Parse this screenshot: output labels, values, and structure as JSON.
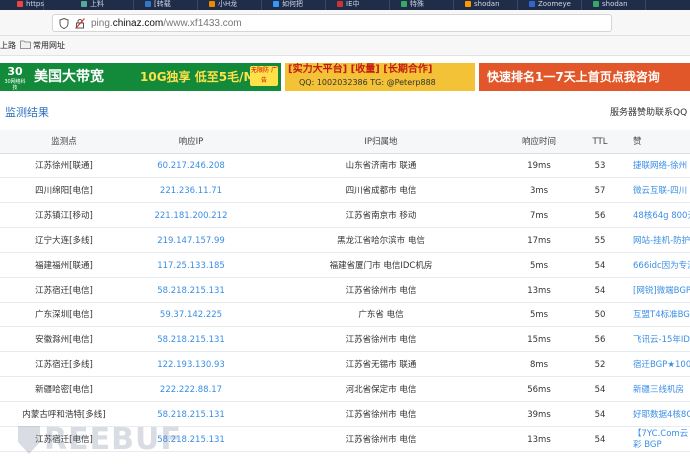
{
  "browser": {
    "tabs": [
      "https",
      "上料",
      "[转载",
      "小H龙",
      "如何把",
      "IE中",
      "特殊",
      "shodan",
      "Zoomeye",
      "shodan"
    ],
    "url_prefix": "ping.",
    "url_domain": "chinaz.com",
    "url_path": "/www.xf1433.com",
    "bookmarks": [
      "上路",
      "常用网址"
    ]
  },
  "banners": {
    "b1_logo": "30",
    "b1_logo_sub": "30网络科技",
    "b1_text": "美国大带宽",
    "b1_offer": "10G独享 低至5毛/M",
    "b1_tag": "无限防 广告",
    "b2_line1": "[实力大平台] [收量] [长期合作]",
    "b2_line2": "QQ: 1002032386  TG: @Peterp888",
    "b3_text": "快速排名1一7天上首页点我咨询"
  },
  "section": {
    "title": "监测结果",
    "right_text": "服务器赞助联系QQ"
  },
  "table": {
    "headers": [
      "监测点",
      "响应IP",
      "IP归属地",
      "响应时间",
      "TTL",
      "赞"
    ],
    "rows": [
      {
        "site": "江苏徐州[联通]",
        "ip": "60.217.246.208",
        "loc": "山东省济南市 联通",
        "time": "19ms",
        "ttl": "53",
        "sponsor": "捷联网络-徐州"
      },
      {
        "site": "四川绵阳[电信]",
        "ip": "221.236.11.71",
        "loc": "四川省成都市 电信",
        "time": "3ms",
        "ttl": "57",
        "sponsor": "微云互联-四川"
      },
      {
        "site": "江苏镇江[移动]",
        "ip": "221.181.200.212",
        "loc": "江苏省南京市 移动",
        "time": "7ms",
        "ttl": "56",
        "sponsor": "48核64g 800元"
      },
      {
        "site": "辽宁大连[多线]",
        "ip": "219.147.157.99",
        "loc": "黑龙江省哈尔滨市 电信",
        "time": "17ms",
        "ttl": "55",
        "sponsor": "网站-挂机-防护"
      },
      {
        "site": "福建福州[联通]",
        "ip": "117.25.133.185",
        "loc": "福建省厦门市 电信IDC机房",
        "time": "5ms",
        "ttl": "54",
        "sponsor": "666idc因为专注"
      },
      {
        "site": "江苏宿迁[电信]",
        "ip": "58.218.215.131",
        "loc": "江苏省徐州市 电信",
        "time": "13ms",
        "ttl": "54",
        "sponsor": "[网锐]微端BGP"
      },
      {
        "site": "广东深圳[电信]",
        "ip": "59.37.142.225",
        "loc": "广东省 电信",
        "time": "5ms",
        "ttl": "50",
        "sponsor": "互盟T4标准BGP"
      },
      {
        "site": "安徽滁州[电信]",
        "ip": "58.218.215.131",
        "loc": "江苏省徐州市 电信",
        "time": "15ms",
        "ttl": "56",
        "sponsor": "飞讯云-15年IDC"
      },
      {
        "site": "江苏宿迁[多线]",
        "ip": "122.193.130.93",
        "loc": "江苏省无锡市 联通",
        "time": "8ms",
        "ttl": "52",
        "sponsor": "宿迁BGP★100"
      },
      {
        "site": "新疆哈密[电信]",
        "ip": "222.222.88.17",
        "loc": "河北省保定市 电信",
        "time": "56ms",
        "ttl": "54",
        "sponsor": "新疆三线机房"
      },
      {
        "site": "内蒙古呼和浩特[多线]",
        "ip": "58.218.215.131",
        "loc": "江苏省徐州市 电信",
        "time": "39ms",
        "ttl": "54",
        "sponsor": "好耶数据4核8G"
      },
      {
        "site": "江苏宿迁[电信]",
        "ip": "58.218.215.131",
        "loc": "江苏省徐州市 电信",
        "time": "13ms",
        "ttl": "54",
        "sponsor": "【7YC.Com云彩 BGP"
      }
    ]
  },
  "watermark": "REEBUF",
  "colors": {
    "link": "#3a8ee6",
    "title": "#2e6fbf",
    "banner_green": "#128a3a",
    "banner_yellow": "#f3c236",
    "banner_orange": "#e2572a"
  }
}
